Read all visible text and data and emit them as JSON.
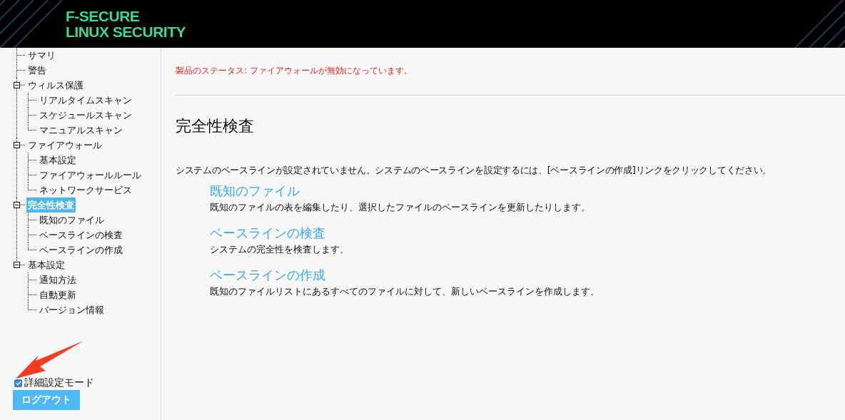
{
  "header": {
    "logo_lines": [
      "F-SECURE",
      "LINUX SECURITY"
    ]
  },
  "sidebar": {
    "tree": [
      {
        "label": "サマリ",
        "selected": false
      },
      {
        "label": "警告",
        "selected": false
      },
      {
        "label": "ウィルス保護",
        "selected": false,
        "expanded": true,
        "children": [
          {
            "label": "リアルタイムスキャン",
            "selected": false
          },
          {
            "label": "スケジュールスキャン",
            "selected": false
          },
          {
            "label": "マニュアルスキャン",
            "selected": false
          }
        ]
      },
      {
        "label": "ファイアウォール",
        "selected": false,
        "expanded": true,
        "children": [
          {
            "label": "基本設定",
            "selected": false
          },
          {
            "label": "ファイアウォールルール",
            "selected": false
          },
          {
            "label": "ネットワークサービス",
            "selected": false
          }
        ]
      },
      {
        "label": "完全性検査",
        "selected": true,
        "expanded": true,
        "children": [
          {
            "label": "既知のファイル",
            "selected": false
          },
          {
            "label": "ベースラインの検査",
            "selected": false
          },
          {
            "label": "ベースラインの作成",
            "selected": false
          }
        ]
      },
      {
        "label": "基本設定",
        "selected": false,
        "expanded": true,
        "children": [
          {
            "label": "通知方法",
            "selected": false
          },
          {
            "label": "自動更新",
            "selected": false
          },
          {
            "label": "バージョン情報",
            "selected": false
          }
        ]
      }
    ],
    "advanced_mode": {
      "label": "詳細設定モード",
      "checked": true
    },
    "logout_button": "ログアウト"
  },
  "main": {
    "status": "製品のステータス: ファイアウォールが無効になっています。",
    "title": "完全性検査",
    "intro": "システムのベースラインが設定されていません。システムのベースラインを設定するには、[ベースラインの作成]リンクをクリックしてください。",
    "links": [
      {
        "title": "既知のファイル",
        "description": "既知のファイルの表を編集したり、選択したファイルのベースラインを更新したりします。"
      },
      {
        "title": "ベースラインの検査",
        "description": "システムの完全性を検査します。"
      },
      {
        "title": "ベースラインの作成",
        "description": "既知のファイルリストにあるすべてのファイルに対して、新しいベースラインを作成します。"
      }
    ]
  }
}
